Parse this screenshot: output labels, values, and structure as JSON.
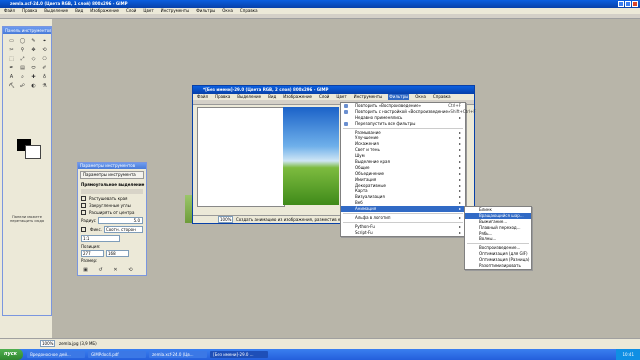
{
  "gimp_window": {
    "title": "zemla.xcf-24.0 (Цвета RGB, 1 слой) 800x296 - GIMP",
    "menu": [
      "Файл",
      "Правка",
      "Выделение",
      "Вид",
      "Изображение",
      "Слой",
      "Цвет",
      "Инструменты",
      "Фильтры",
      "Окна",
      "Справка"
    ]
  },
  "toolbox": {
    "title": "Панель инструментов"
  },
  "dock_hint": "Панели можете перетащить сюда",
  "tool_options": {
    "title": "Параметры инструментов",
    "tab": "Параметры инструмента",
    "section": "Прямоугольное выделение",
    "items": [
      "Растушевать края",
      "Закругленные углы",
      "Расширять от центра"
    ],
    "radius_label": "Радиус",
    "radius_value": "5.0",
    "fixed_label": "Фикс.",
    "fixed_value": "Соотн. сторон",
    "ratio_value": "1:1",
    "pos_label": "Позиция:",
    "pos_x": "277",
    "pos_y": "168",
    "size_label": "Размер:"
  },
  "image_window": {
    "title": "*[Без имени]-29.0 (Цвета RGB, 2 слоя) 800x296 - GIMP",
    "menu": [
      "Файл",
      "Правка",
      "Выделение",
      "Вид",
      "Изображение",
      "Слой",
      "Цвет",
      "Инструменты",
      "Фильтры",
      "Окна",
      "Справка"
    ],
    "zoom": "100%",
    "status": "Создать анимацию из изображения, разместив его в кадре"
  },
  "filters_menu": {
    "items": [
      {
        "label": "Повторить «Воспроизведение»",
        "shortcut": "Ctrl+F",
        "icon": "repeat-icon"
      },
      {
        "label": "Повторить с настройкой «Воспроизведение»",
        "shortcut": "Shift+Ctrl+F",
        "icon": "reshow-icon"
      },
      {
        "label": "Недавно применялись",
        "shortcut": "▸"
      },
      {
        "label": "Перезапустить все фильтры",
        "shortcut": "",
        "icon": "reset-icon"
      },
      {
        "sep": true
      },
      {
        "label": "Размывание",
        "shortcut": "▸"
      },
      {
        "label": "Улучшение",
        "shortcut": "▸"
      },
      {
        "label": "Искажения",
        "shortcut": "▸"
      },
      {
        "label": "Свет и тень",
        "shortcut": "▸"
      },
      {
        "label": "Шум",
        "shortcut": "▸"
      },
      {
        "label": "Выделение края",
        "shortcut": "▸"
      },
      {
        "label": "Общие",
        "shortcut": "▸"
      },
      {
        "label": "Объединение",
        "shortcut": "▸"
      },
      {
        "label": "Имитация",
        "shortcut": "▸"
      },
      {
        "label": "Декоративные",
        "shortcut": "▸"
      },
      {
        "label": "Карта",
        "shortcut": "▸"
      },
      {
        "label": "Визуализация",
        "shortcut": "▸"
      },
      {
        "label": "Веб",
        "shortcut": "▸"
      },
      {
        "label": "Анимация",
        "shortcut": "▸",
        "active": true
      },
      {
        "sep": true
      },
      {
        "label": "Альфа в логотип",
        "shortcut": "▸"
      },
      {
        "sep": true
      },
      {
        "label": "Python-Fu",
        "shortcut": "▸"
      },
      {
        "label": "Script-Fu",
        "shortcut": "▸"
      }
    ]
  },
  "animation_submenu": {
    "items": [
      {
        "label": "Блинк"
      },
      {
        "label": "Вращающийся шар...",
        "active": true
      },
      {
        "label": "Выжигание..."
      },
      {
        "label": "Плавный переход..."
      },
      {
        "label": "Рябь..."
      },
      {
        "label": "Волны..."
      },
      {
        "sep": true
      },
      {
        "label": "Воспроизведение..."
      },
      {
        "label": "Оптимизация (для GIF)"
      },
      {
        "label": "Оптимизация (Разница)"
      },
      {
        "label": "Разоптимизировать"
      }
    ]
  },
  "bottom_status": {
    "zoom": "100%",
    "file": "zemla.jpg (3,9 МБ)"
  },
  "taskbar": {
    "start": "пуск",
    "buttons": [
      "Вредоносное дей...",
      "GIMPdoc4.pdf",
      "zemla.xcf-24.0 (Цв...",
      "[Без имени]-29.0 ..."
    ],
    "clock": "10:41"
  },
  "colors": {
    "title": "#0a5fe0",
    "menu_highlight": "#316ac5",
    "taskbar": "#245edb",
    "start": "#3c9a3c"
  }
}
